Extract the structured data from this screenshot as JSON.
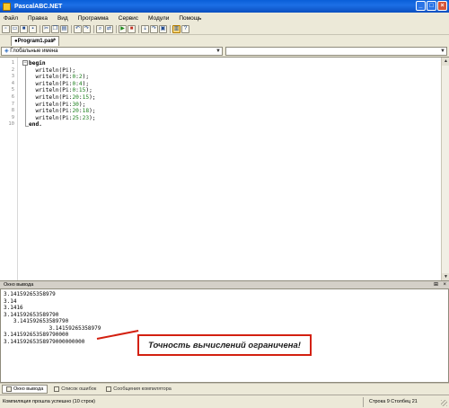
{
  "window": {
    "title": "PascalABC.NET",
    "minimize": "_",
    "maximize": "□",
    "close": "×"
  },
  "menu": [
    "Файл",
    "Правка",
    "Вид",
    "Программа",
    "Сервис",
    "Модули",
    "Помощь"
  ],
  "toolbar": [
    {
      "name": "new-file-icon",
      "glyph": "▫",
      "style": ""
    },
    {
      "name": "open-file-icon",
      "glyph": "▭",
      "style": ""
    },
    {
      "name": "save-icon",
      "glyph": "■",
      "style": ""
    },
    {
      "name": "save-all-icon",
      "glyph": "▪",
      "style": ""
    },
    {
      "sep": true
    },
    {
      "name": "cut-icon",
      "glyph": "✂",
      "style": ""
    },
    {
      "name": "copy-icon",
      "glyph": "❐",
      "style": ""
    },
    {
      "name": "paste-icon",
      "glyph": "▤",
      "style": ""
    },
    {
      "sep": true
    },
    {
      "name": "undo-icon",
      "glyph": "↶",
      "style": ""
    },
    {
      "name": "redo-icon",
      "glyph": "↷",
      "style": ""
    },
    {
      "sep": true
    },
    {
      "name": "find-icon",
      "glyph": "⌕",
      "style": ""
    },
    {
      "name": "replace-icon",
      "glyph": "⇄",
      "style": ""
    },
    {
      "sep": true
    },
    {
      "name": "run-icon",
      "glyph": "▶",
      "style": "green"
    },
    {
      "name": "stop-icon",
      "glyph": "■",
      "style": "red"
    },
    {
      "sep": true
    },
    {
      "name": "step-into-icon",
      "glyph": "⇣",
      "style": ""
    },
    {
      "name": "step-over-icon",
      "glyph": "↷",
      "style": ""
    },
    {
      "name": "debug-window-icon",
      "glyph": "▣",
      "style": ""
    },
    {
      "sep": true
    },
    {
      "name": "output-window-icon",
      "glyph": "▥",
      "style": "hl"
    },
    {
      "name": "help-icon",
      "glyph": "?",
      "style": ""
    }
  ],
  "editor_tab": {
    "label": "●Program1.pas*",
    "close": "×"
  },
  "scope_combo": {
    "value": "Глобальные имена",
    "icon": "class-scope-icon"
  },
  "member_combo": {
    "value": ""
  },
  "code": {
    "line_numbers": [
      "1",
      "2",
      "3",
      "4",
      "5",
      "6",
      "7",
      "8",
      "9",
      "10"
    ],
    "lines": [
      [
        {
          "t": "begin",
          "c": "kw"
        }
      ],
      [
        {
          "t": "  writeln(Pi);",
          "c": ""
        }
      ],
      [
        {
          "t": "  writeln(Pi:",
          "c": ""
        },
        {
          "t": "0",
          "c": "num"
        },
        {
          "t": ":",
          "c": ""
        },
        {
          "t": "2",
          "c": "num"
        },
        {
          "t": ");",
          "c": ""
        }
      ],
      [
        {
          "t": "  writeln(Pi:",
          "c": ""
        },
        {
          "t": "0",
          "c": "num"
        },
        {
          "t": ":",
          "c": ""
        },
        {
          "t": "4",
          "c": "num"
        },
        {
          "t": ");",
          "c": ""
        }
      ],
      [
        {
          "t": "  writeln(Pi:",
          "c": ""
        },
        {
          "t": "0",
          "c": "num"
        },
        {
          "t": ":",
          "c": ""
        },
        {
          "t": "15",
          "c": "num"
        },
        {
          "t": ");",
          "c": ""
        }
      ],
      [
        {
          "t": "  writeln(Pi:",
          "c": ""
        },
        {
          "t": "20",
          "c": "num"
        },
        {
          "t": ":",
          "c": ""
        },
        {
          "t": "15",
          "c": "num"
        },
        {
          "t": ");",
          "c": ""
        }
      ],
      [
        {
          "t": "  writeln(Pi:",
          "c": ""
        },
        {
          "t": "30",
          "c": "num"
        },
        {
          "t": ");",
          "c": ""
        }
      ],
      [
        {
          "t": "  writeln(Pi:",
          "c": ""
        },
        {
          "t": "20",
          "c": "num"
        },
        {
          "t": ":",
          "c": ""
        },
        {
          "t": "18",
          "c": "num"
        },
        {
          "t": ");",
          "c": ""
        }
      ],
      [
        {
          "t": "  writeln(Pi:",
          "c": ""
        },
        {
          "t": "25",
          "c": "num"
        },
        {
          "t": ":",
          "c": ""
        },
        {
          "t": "23",
          "c": "num"
        },
        {
          "t": ");",
          "c": ""
        }
      ],
      [
        {
          "t": "end.",
          "c": "kw"
        }
      ]
    ]
  },
  "output_window": {
    "title": "Окно вывода",
    "pin": "⊞",
    "close": "×",
    "lines": [
      "3.14159265358979",
      "3.14",
      "3.1416",
      "3.141592653589790",
      "   3.141592653589790",
      "              3.14159265358979",
      "3.141592653589790000",
      "3.14159265358979000000000"
    ]
  },
  "callout": {
    "text": "Точность вычислений ограничена!",
    "border_color": "#d32010"
  },
  "bottom_tabs": [
    "Окно вывода",
    "Список ошибок",
    "Сообщения компилятора"
  ],
  "status": {
    "message": "Компиляция прошла успешно (10 строк)",
    "position": "Строка  9  Столбец  21"
  }
}
